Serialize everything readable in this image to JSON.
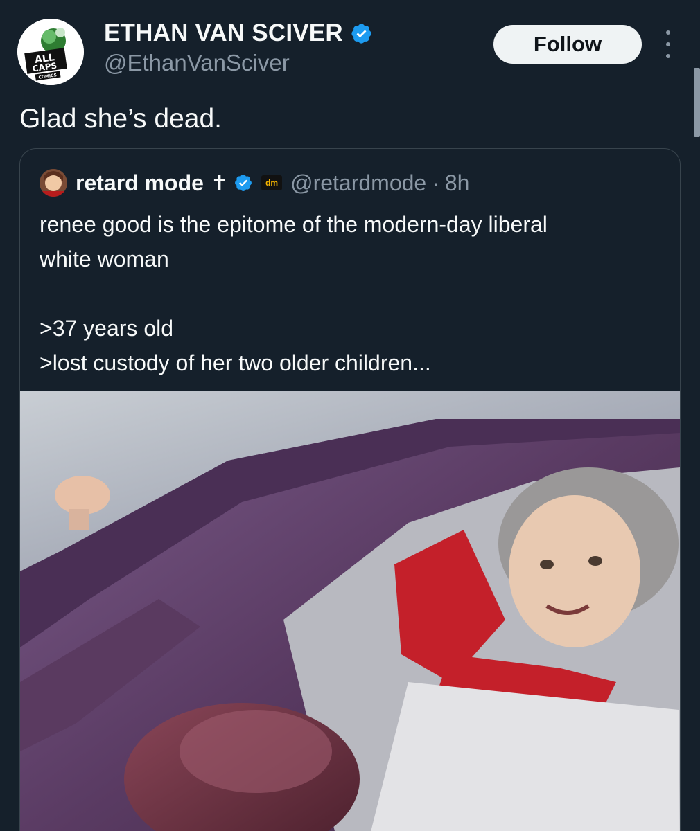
{
  "author": {
    "name": "ETHAN VAN SCIVER",
    "handle": "@EthanVanSciver",
    "avatar_icon": "all-caps-comics-logo",
    "avatar_logo_text": "ALL CAPS COMICS",
    "verified_icon": "verified-badge-icon"
  },
  "actions": {
    "follow_label": "Follow",
    "more_icon": "more-vertical-icon"
  },
  "tweet": {
    "text": "Glad she’s dead."
  },
  "quote": {
    "name": "retard mode",
    "cross": "✝",
    "badge_text": "dm",
    "handle": "@retardmode",
    "separator": "·",
    "time": "8h",
    "lines": [
      "renee good is the epitome of the modern-day liberal",
      "white woman",
      "",
      ">37 years old",
      ">lost custody of her two older children..."
    ],
    "media_icon": "video-still-photo"
  },
  "colors": {
    "background": "#15202b",
    "text": "#f7f9f9",
    "secondary": "#8b98a5",
    "verified_blue": "#1d9bf0",
    "follow_bg": "#eff3f4"
  }
}
